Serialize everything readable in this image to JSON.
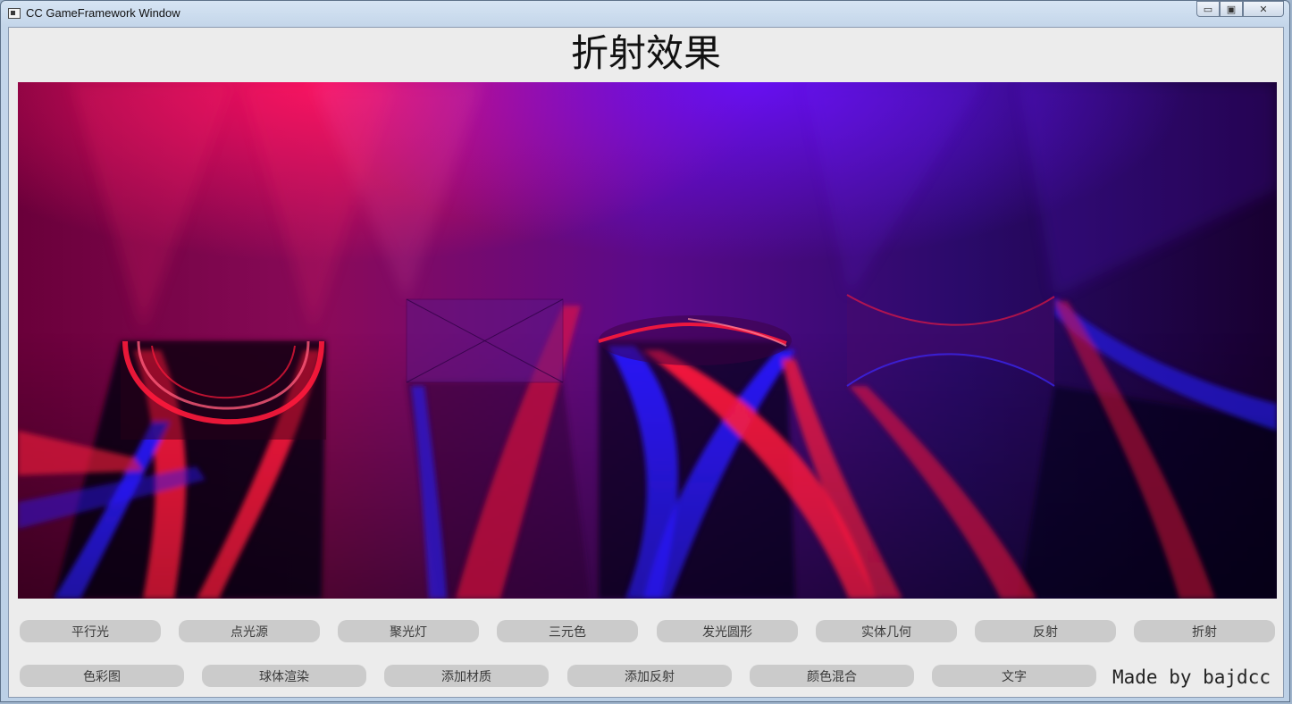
{
  "window": {
    "title": "CC GameFramework Window",
    "controls": {
      "minimize": "▭",
      "maximize": "▣",
      "close": "✕"
    }
  },
  "page_title": "折射效果",
  "toolbar_row1": [
    "平行光",
    "点光源",
    "聚光灯",
    "三元色",
    "发光圆形",
    "实体几何",
    "反射",
    "折射"
  ],
  "toolbar_row2": [
    "色彩图",
    "球体渲染",
    "添加材质",
    "添加反射",
    "颜色混合",
    "文字"
  ],
  "credit": "Made by bajdcc",
  "colors": {
    "red_light": "#ff1a3c",
    "blue_light": "#2a1aff",
    "background": "#3a0030",
    "button": "#cbcbcb"
  }
}
